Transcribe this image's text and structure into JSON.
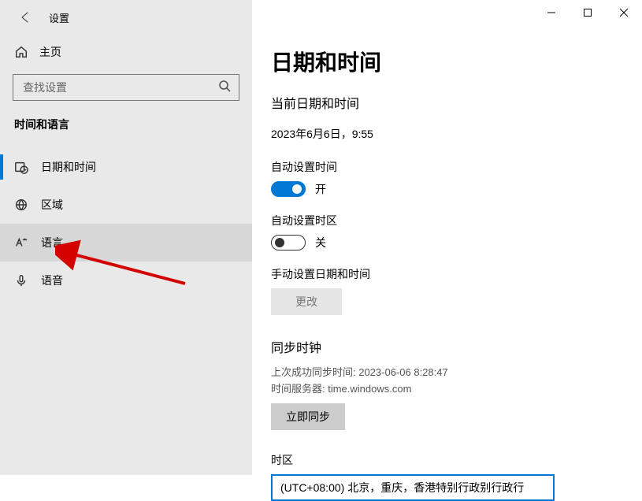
{
  "app": {
    "title": "设置"
  },
  "sidebar": {
    "home_label": "主页",
    "search_placeholder": "查找设置",
    "category": "时间和语言",
    "items": [
      {
        "label": "日期和时间",
        "icon": "clock-calendar-icon",
        "active": true
      },
      {
        "label": "区域",
        "icon": "globe-icon",
        "active": false
      },
      {
        "label": "语言",
        "icon": "language-icon",
        "active": false,
        "hover": true
      },
      {
        "label": "语音",
        "icon": "microphone-icon",
        "active": false
      }
    ]
  },
  "main": {
    "page_title": "日期和时间",
    "current_heading": "当前日期和时间",
    "current_value": "2023年6月6日，9:55",
    "auto_time": {
      "label": "自动设置时间",
      "on": true,
      "state_text": "开"
    },
    "auto_tz": {
      "label": "自动设置时区",
      "on": false,
      "state_text": "关"
    },
    "manual": {
      "label": "手动设置日期和时间",
      "button": "更改",
      "enabled": false
    },
    "sync": {
      "heading": "同步时钟",
      "last_label": "上次成功同步时间: 2023-06-06 8:28:47",
      "server_label": "时间服务器: time.windows.com",
      "button": "立即同步"
    },
    "timezone": {
      "label": "时区",
      "value": "(UTC+08:00) 北京，重庆，香港特别行政别行政行"
    }
  }
}
